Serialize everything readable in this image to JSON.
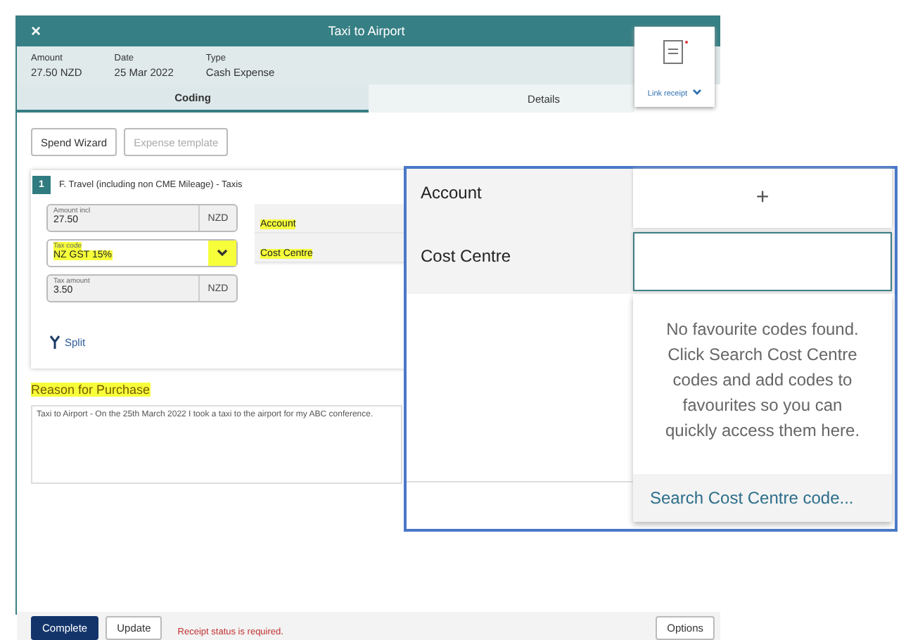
{
  "window": {
    "close": "×",
    "title": "Taxi to Airport"
  },
  "summary": [
    {
      "label": "Amount",
      "value": "27.50 NZD"
    },
    {
      "label": "Date",
      "value": "25 Mar 2022"
    },
    {
      "label": "Type",
      "value": "Cash Expense"
    }
  ],
  "tabs": [
    {
      "label": "Coding",
      "selected": true
    },
    {
      "label": "Details",
      "selected": false
    }
  ],
  "receipt": {
    "link": "Link receipt"
  },
  "toolbar": [
    {
      "label": "Spend Wizard",
      "disabled": false
    },
    {
      "label": "Expense template",
      "disabled": true
    }
  ],
  "line": {
    "number": "1",
    "title": "F. Travel (including non CME Mileage)  -  Taxis",
    "fields": [
      {
        "kind": "amount",
        "label": "Amount incl",
        "value": "27.50",
        "unit": "NZD",
        "highlighted": false
      },
      {
        "kind": "select",
        "label": "Tax code",
        "value": "NZ GST 15%",
        "highlighted": true
      },
      {
        "kind": "amount",
        "label": "Tax amount",
        "value": "3.50",
        "unit": "NZD",
        "highlighted": false
      }
    ],
    "coding": [
      {
        "label": "Account",
        "highlighted": true
      },
      {
        "label": "Cost Centre",
        "highlighted": true
      }
    ],
    "split": "Split"
  },
  "reason": {
    "heading": "Reason for Purchase",
    "highlighted": true,
    "text": "Taxi to Airport - On the 25th March 2022 I took a taxi to the airport for my ABC conference."
  },
  "footer": {
    "buttons": [
      {
        "label": "Complete",
        "primary": true
      },
      {
        "label": "Update",
        "primary": false
      }
    ],
    "error": "Receipt status is required.",
    "options": "Options"
  },
  "callout": {
    "rows": [
      {
        "label": "Account",
        "value": "+",
        "focused": false
      },
      {
        "label": "Cost Centre",
        "value": "",
        "focused": true
      }
    ],
    "message": "No favourite codes found. Click Search Cost Centre codes and add codes to favourites so you can quickly access them here.",
    "search": "Search Cost Centre code..."
  }
}
